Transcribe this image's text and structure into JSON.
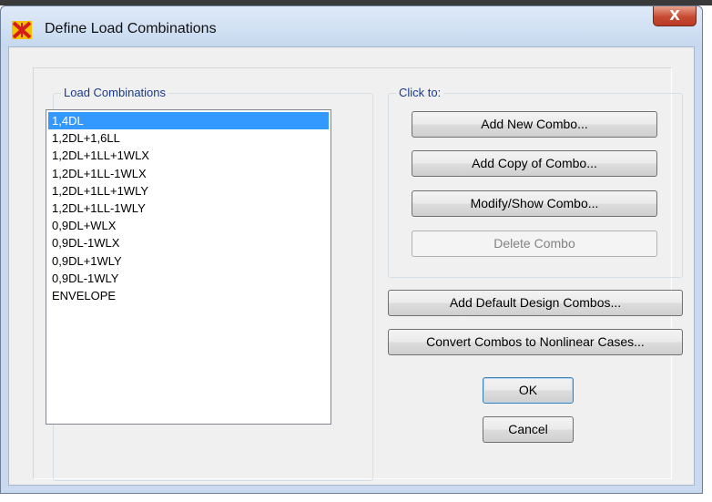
{
  "window": {
    "title": "Define Load Combinations",
    "close_label": "X"
  },
  "load_combinations": {
    "label": "Load Combinations",
    "items": [
      "1,4DL",
      "1,2DL+1,6LL",
      "1,2DL+1LL+1WLX",
      "1,2DL+1LL-1WLX",
      "1,2DL+1LL+1WLY",
      "1,2DL+1LL-1WLY",
      "0,9DL+WLX",
      "0,9DL-1WLX",
      "0,9DL+1WLY",
      "0,9DL-1WLY",
      "ENVELOPE"
    ],
    "selected": "1,4DL"
  },
  "click_to": {
    "label": "Click to:",
    "add_new": "Add New Combo...",
    "add_copy": "Add Copy of Combo...",
    "modify_show": "Modify/Show Combo...",
    "delete": "Delete Combo"
  },
  "actions": {
    "add_default": "Add Default Design Combos...",
    "convert": "Convert Combos to Nonlinear Cases...",
    "ok": "OK",
    "cancel": "Cancel"
  },
  "colors": {
    "selection": "#3399ff",
    "group_label": "#1a3a8a",
    "close_button": "#c74a32"
  }
}
